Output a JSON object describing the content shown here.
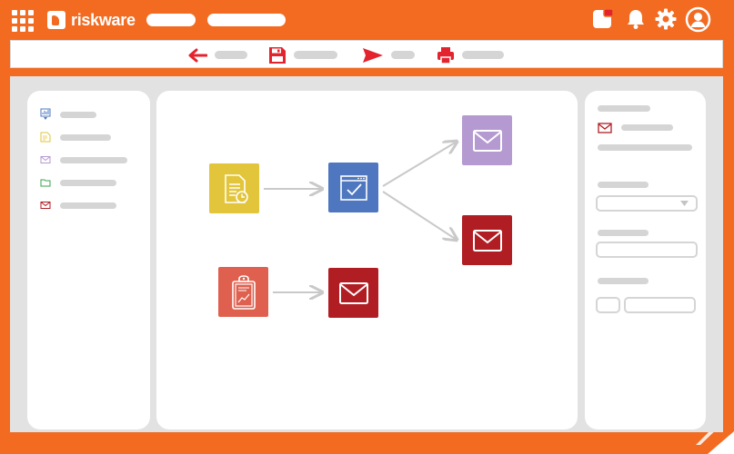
{
  "app": {
    "brand": "riskware",
    "colors": {
      "frame": "#f26b21",
      "yellow": "#e2c53a",
      "blue": "#4e77c0",
      "lavender": "#b59ad1",
      "crimson": "#b01e24",
      "coral": "#e0604f",
      "icon_red": "#e3232e"
    }
  },
  "header": {
    "grid_icon": "apps-grid-icon",
    "icons": [
      "notification-badge-icon",
      "bell-icon",
      "gear-icon",
      "user-avatar-icon"
    ]
  },
  "toolbar": {
    "icons": [
      "back-arrow-icon",
      "save-icon",
      "send-icon",
      "print-icon"
    ]
  },
  "sidebar": {
    "items": [
      {
        "icon": "report-icon"
      },
      {
        "icon": "document-icon"
      },
      {
        "icon": "envelope-icon"
      },
      {
        "icon": "folder-icon"
      },
      {
        "icon": "envelope-icon"
      }
    ]
  },
  "workflow": {
    "nodes": [
      {
        "id": "scheduled-document",
        "icon": "document-clock-icon",
        "color": "#e2c53a"
      },
      {
        "id": "approval-window",
        "icon": "window-check-icon",
        "color": "#4e77c0"
      },
      {
        "id": "email-lavender",
        "icon": "envelope-icon",
        "color": "#b59ad1"
      },
      {
        "id": "email-red-top",
        "icon": "envelope-icon",
        "color": "#b01e24"
      },
      {
        "id": "clipboard-report",
        "icon": "clipboard-icon",
        "color": "#e0604f"
      },
      {
        "id": "email-red-bottom",
        "icon": "envelope-icon",
        "color": "#b01e24"
      }
    ]
  },
  "properties": {
    "icon": "envelope-icon"
  }
}
